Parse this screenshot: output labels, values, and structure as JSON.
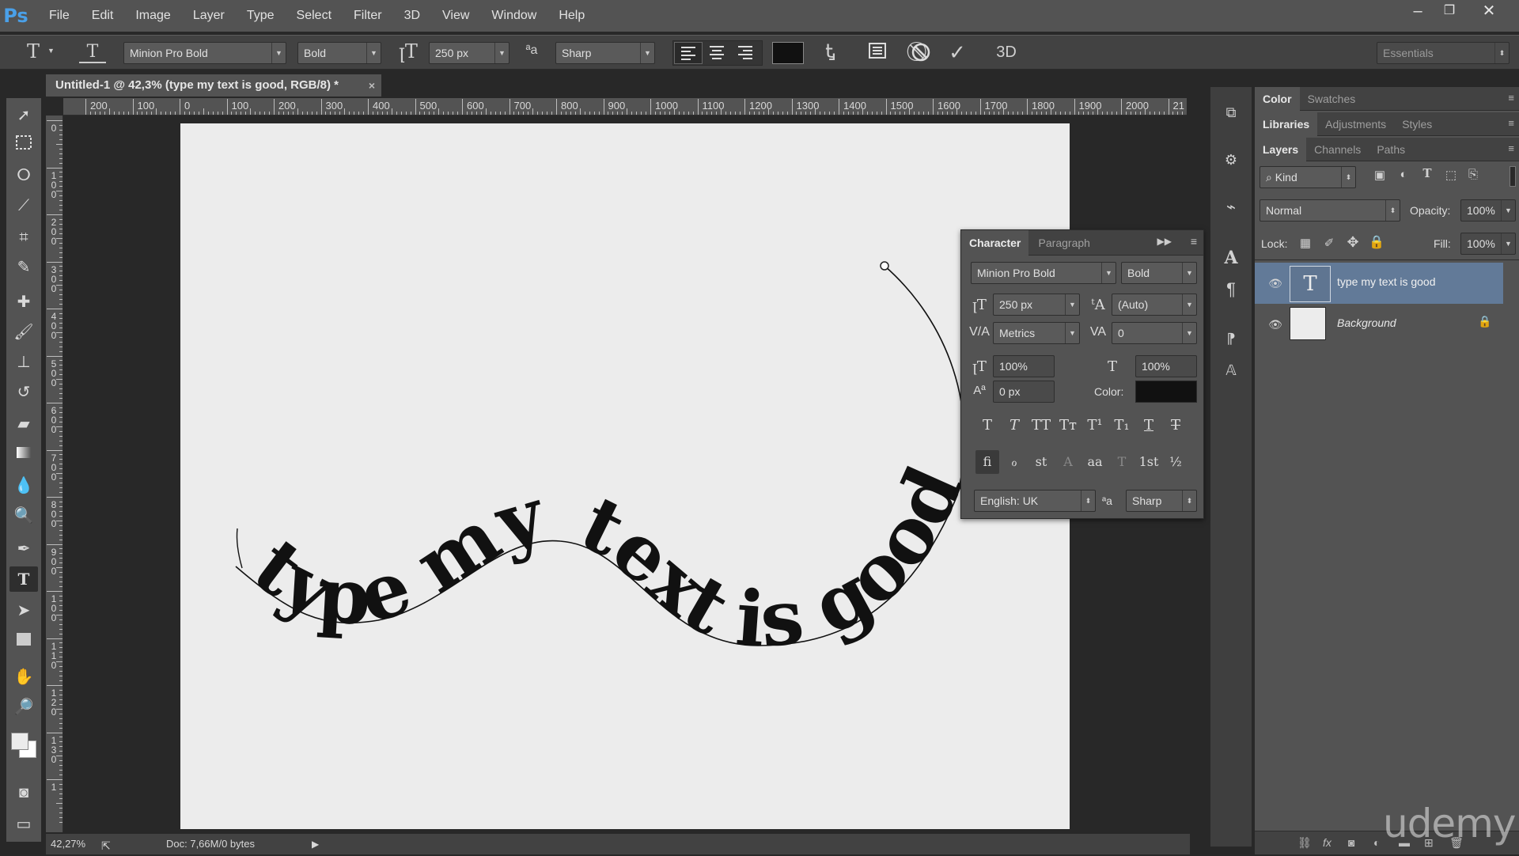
{
  "app": {
    "logo": "Ps"
  },
  "menu": [
    "File",
    "Edit",
    "Image",
    "Layer",
    "Type",
    "Select",
    "Filter",
    "3D",
    "View",
    "Window",
    "Help"
  ],
  "window_controls": {
    "minimize": "–",
    "restore": "❐",
    "close": "✕"
  },
  "options_bar": {
    "font_family": "Minion Pro Bold",
    "font_style": "Bold",
    "font_size": "250 px",
    "aa_label": "ªa",
    "antialias": "Sharp",
    "color_swatch": "#111111",
    "threed_label": "3D",
    "workspace": "Essentials"
  },
  "document": {
    "tab_title": "Untitled-1 @ 42,3% (type my text is good, RGB/8) *",
    "tab_close": "×",
    "zoom": "42,27%",
    "doc_info": "Doc: 7,66M/0 bytes",
    "canvas_color": "#ececec",
    "path_text": "type my text is good"
  },
  "ruler": {
    "top_ticks": [
      "200",
      "100",
      "0",
      "100",
      "200",
      "300",
      "400",
      "500",
      "600",
      "700",
      "800",
      "900",
      "1000",
      "1100",
      "1200",
      "1300",
      "1400",
      "1500",
      "1600",
      "1700",
      "1800",
      "1900",
      "2000",
      "21"
    ],
    "left_ticks": [
      "0",
      "1\n0\n0",
      "2\n0\n0",
      "3\n0\n0",
      "4\n0\n0",
      "5\n0\n0",
      "6\n0\n0",
      "7\n0\n0",
      "8\n0\n0",
      "9\n0\n0",
      "1\n0\n0",
      "1\n1\n0",
      "1\n2\n0",
      "1\n3\n0",
      "1\n"
    ]
  },
  "character_panel": {
    "tabs": [
      "Character",
      "Paragraph"
    ],
    "font_family": "Minion Pro Bold",
    "font_style": "Bold",
    "size": "250 px",
    "leading": "(Auto)",
    "kerning": "Metrics",
    "tracking": "0",
    "vscale": "100%",
    "hscale": "100%",
    "baseline": "0 px",
    "color_label": "Color:",
    "color": "#111111",
    "language": "English: UK",
    "aa_label": "ªa",
    "antialias": "Sharp",
    "type_style_buttons": [
      "T",
      "T",
      "TT",
      "Tт",
      "T¹",
      "T₁",
      "T",
      "T"
    ],
    "opentype_buttons": [
      "ﬁ",
      "ℴ",
      "st",
      "A",
      "aa",
      "T",
      "1st",
      "½"
    ]
  },
  "color_panel_tabs": [
    "Color",
    "Swatches"
  ],
  "library_tabs": [
    "Libraries",
    "Adjustments",
    "Styles"
  ],
  "layers_panel": {
    "tabs": [
      "Layers",
      "Channels",
      "Paths"
    ],
    "filter": "Kind",
    "blend_mode": "Normal",
    "opacity_label": "Opacity:",
    "opacity": "100%",
    "lock_label": "Lock:",
    "fill_label": "Fill:",
    "fill": "100%",
    "layers": [
      {
        "name": "type my text is good",
        "thumb": "T",
        "selected": true
      },
      {
        "name": "Background",
        "thumb": "",
        "selected": false
      }
    ]
  },
  "watermark": "udemy"
}
